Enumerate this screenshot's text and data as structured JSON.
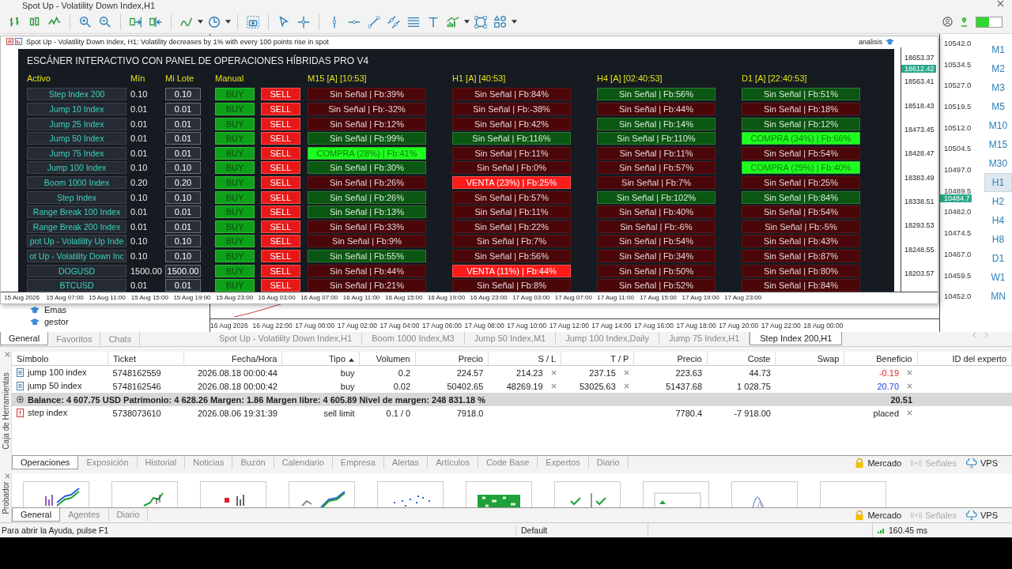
{
  "app_title": "Spot Up - Volatility Down Index,H1",
  "chart_window": {
    "symbol_line": "Spot Up - Volatility Down Index, H1:  Volatility decreases by 1% with every 100 points rise in spot",
    "badge": "analisis",
    "price_labels": [
      "18653.37",
      "18563.41",
      "18518.43",
      "18473.45",
      "18428.47",
      "18383.49",
      "18338.51",
      "18293.53",
      "18248.55",
      "18203.57"
    ],
    "current_price": "18612.42",
    "time_labels": [
      "15 Aug 2026",
      "15 Aug 07:00",
      "15 Aug 11:00",
      "15 Aug 15:00",
      "15 Aug 19:00",
      "15 Aug 23:00",
      "16 Aug 03:00",
      "16 Aug 07:00",
      "16 Aug 11:00",
      "16 Aug 15:00",
      "16 Aug 19:00",
      "16 Aug 23:00",
      "17 Aug 03:00",
      "17 Aug 07:00",
      "17 Aug 11:00",
      "17 Aug 15:00",
      "17 Aug 19:00",
      "17 Aug 23:00"
    ]
  },
  "scanner": {
    "title": "ESCÁNER INTERACTIVO CON PANEL DE OPERACIONES HÍBRIDAS PRO V4",
    "headers": {
      "asset": "Activo",
      "min": "Mín",
      "lot": "Mi Lote",
      "manual": "Manual",
      "timeframes": [
        "M15 [A] [10:53]",
        "H1 [A] [40:53]",
        "H4 [A] [02:40:53]",
        "D1 [A] [22:40:53]"
      ]
    },
    "rows": [
      {
        "symbol": "Step Index 200",
        "min": "0.10",
        "lot": "0.10",
        "buy": "BUY",
        "sell": "SELL",
        "signals": [
          {
            "text": "Sin Señal | Fb:39%",
            "kind": "weak_down"
          },
          {
            "text": "Sin Señal | Fb:84%",
            "kind": "weak_down"
          },
          {
            "text": "Sin Señal | Fb:56%",
            "kind": "weak_up"
          },
          {
            "text": "Sin Señal | Fb:51%",
            "kind": "weak_up"
          }
        ]
      },
      {
        "symbol": "Jump 10 Index",
        "min": "0.01",
        "lot": "0.01",
        "buy": "BUY",
        "sell": "SELL",
        "signals": [
          {
            "text": "Sin Señal | Fb:-32%",
            "kind": "weak_down"
          },
          {
            "text": "Sin Señal | Fb:-38%",
            "kind": "weak_down"
          },
          {
            "text": "Sin Señal | Fb:44%",
            "kind": "weak_down"
          },
          {
            "text": "Sin Señal | Fb:18%",
            "kind": "weak_down"
          }
        ]
      },
      {
        "symbol": "Jump 25 Index",
        "min": "0.01",
        "lot": "0.01",
        "buy": "BUY",
        "sell": "SELL",
        "signals": [
          {
            "text": "Sin Señal | Fb:12%",
            "kind": "weak_down"
          },
          {
            "text": "Sin Señal | Fb:42%",
            "kind": "weak_down"
          },
          {
            "text": "Sin Señal | Fb:14%",
            "kind": "weak_up"
          },
          {
            "text": "Sin Señal | Fb:12%",
            "kind": "weak_up"
          }
        ]
      },
      {
        "symbol": "Jump 50 Index",
        "min": "0.01",
        "lot": "0.01",
        "buy": "BUY",
        "sell": "SELL",
        "signals": [
          {
            "text": "Sin Señal | Fb:99%",
            "kind": "weak_up"
          },
          {
            "text": "Sin Señal | Fb:116%",
            "kind": "weak_up"
          },
          {
            "text": "Sin Señal | Fb:110%",
            "kind": "weak_up"
          },
          {
            "text": "COMPRA (34%) | Fb:66%",
            "kind": "buy"
          }
        ]
      },
      {
        "symbol": "Jump 75 Index",
        "min": "0.01",
        "lot": "0.01",
        "buy": "BUY",
        "sell": "SELL",
        "signals": [
          {
            "text": "COMPRA (28%) | Fb:41%",
            "kind": "buy"
          },
          {
            "text": "Sin Señal | Fb:11%",
            "kind": "weak_down"
          },
          {
            "text": "Sin Señal | Fb:11%",
            "kind": "weak_down"
          },
          {
            "text": "Sin Señal | Fb:54%",
            "kind": "weak_down"
          }
        ]
      },
      {
        "symbol": "Jump 100 Index",
        "min": "0.10",
        "lot": "0.10",
        "buy": "BUY",
        "sell": "SELL",
        "signals": [
          {
            "text": "Sin Señal | Fb:30%",
            "kind": "weak_up"
          },
          {
            "text": "Sin Señal | Fb:0%",
            "kind": "weak_down"
          },
          {
            "text": "Sin Señal | Fb:57%",
            "kind": "weak_down"
          },
          {
            "text": "COMPRA (29%) | Fb:40%",
            "kind": "buy"
          }
        ]
      },
      {
        "symbol": "Boom 1000 Index",
        "min": "0.20",
        "lot": "0.20",
        "buy": "BUY",
        "sell": "SELL",
        "signals": [
          {
            "text": "Sin Señal | Fb:26%",
            "kind": "weak_down"
          },
          {
            "text": "VENTA (23%) | Fb:25%",
            "kind": "sell"
          },
          {
            "text": "Sin Señal | Fb:7%",
            "kind": "weak_down"
          },
          {
            "text": "Sin Señal | Fb:25%",
            "kind": "weak_down"
          }
        ]
      },
      {
        "symbol": "Step Index",
        "min": "0.10",
        "lot": "0.10",
        "buy": "BUY",
        "sell": "SELL",
        "signals": [
          {
            "text": "Sin Señal | Fb:26%",
            "kind": "weak_up"
          },
          {
            "text": "Sin Señal | Fb:57%",
            "kind": "weak_down"
          },
          {
            "text": "Sin Señal | Fb:102%",
            "kind": "weak_up"
          },
          {
            "text": "Sin Señal | Fb:84%",
            "kind": "weak_up"
          }
        ]
      },
      {
        "symbol": "Range Break 100 Index",
        "min": "0.01",
        "lot": "0.01",
        "buy": "BUY",
        "sell": "SELL",
        "signals": [
          {
            "text": "Sin Señal | Fb:13%",
            "kind": "weak_up"
          },
          {
            "text": "Sin Señal | Fb:11%",
            "kind": "weak_down"
          },
          {
            "text": "Sin Señal | Fb:40%",
            "kind": "weak_down"
          },
          {
            "text": "Sin Señal | Fb:54%",
            "kind": "weak_down"
          }
        ]
      },
      {
        "symbol": "Range Break 200 Index",
        "min": "0.01",
        "lot": "0.01",
        "buy": "BUY",
        "sell": "SELL",
        "signals": [
          {
            "text": "Sin Señal | Fb:33%",
            "kind": "weak_down"
          },
          {
            "text": "Sin Señal | Fb:22%",
            "kind": "weak_down"
          },
          {
            "text": "Sin Señal | Fb:-6%",
            "kind": "weak_down"
          },
          {
            "text": "Sin Señal | Fb:-5%",
            "kind": "weak_down"
          }
        ]
      },
      {
        "symbol": "pot Up - Volatility Up Inde",
        "min": "0.10",
        "lot": "0.10",
        "buy": "BUY",
        "sell": "SELL",
        "signals": [
          {
            "text": "Sin Señal | Fb:9%",
            "kind": "weak_down"
          },
          {
            "text": "Sin Señal | Fb:7%",
            "kind": "weak_down"
          },
          {
            "text": "Sin Señal | Fb:54%",
            "kind": "weak_down"
          },
          {
            "text": "Sin Señal | Fb:43%",
            "kind": "weak_down"
          }
        ]
      },
      {
        "symbol": "ot Up - Volatility Down Inc",
        "min": "0.10",
        "lot": "0.10",
        "buy": "BUY",
        "sell": "SELL",
        "signals": [
          {
            "text": "Sin Señal | Fb:55%",
            "kind": "weak_up"
          },
          {
            "text": "Sin Señal | Fb:56%",
            "kind": "weak_down"
          },
          {
            "text": "Sin Señal | Fb:34%",
            "kind": "weak_down"
          },
          {
            "text": "Sin Señal | Fb:87%",
            "kind": "weak_down"
          }
        ]
      },
      {
        "symbol": "DOGUSD",
        "min": "1500.00",
        "lot": "1500.00",
        "buy": "BUY",
        "sell": "SELL",
        "signals": [
          {
            "text": "Sin Señal | Fb:44%",
            "kind": "weak_down"
          },
          {
            "text": "VENTA (11%) | Fb:44%",
            "kind": "sell"
          },
          {
            "text": "Sin Señal | Fb:50%",
            "kind": "weak_down"
          },
          {
            "text": "Sin Señal | Fb:80%",
            "kind": "weak_down"
          }
        ]
      },
      {
        "symbol": "BTCUSD",
        "min": "0.01",
        "lot": "0.01",
        "buy": "BUY",
        "sell": "SELL",
        "signals": [
          {
            "text": "Sin Señal | Fb:21%",
            "kind": "weak_down"
          },
          {
            "text": "Sin Señal | Fb:8%",
            "kind": "weak_down"
          },
          {
            "text": "Sin Señal | Fb:52%",
            "kind": "weak_down"
          },
          {
            "text": "Sin Señal | Fb:84%",
            "kind": "weak_down"
          }
        ]
      }
    ]
  },
  "main_chart": {
    "price_labels": [
      "10542.0",
      "10534.5",
      "10527.0",
      "10519.5",
      "10512.0",
      "10504.5",
      "10497.0",
      "10489.5",
      "10482.0",
      "10474.5",
      "10467.0",
      "10459.5",
      "10452.0"
    ],
    "current_price": "10484.7",
    "time_labels": [
      "16 Aug 2026",
      "16 Aug 22:00",
      "17 Aug 00:00",
      "17 Aug 02:00",
      "17 Aug 04:00",
      "17 Aug 06:00",
      "17 Aug 08:00",
      "17 Aug 10:00",
      "17 Aug 12:00",
      "17 Aug 14:00",
      "17 Aug 16:00",
      "17 Aug 18:00",
      "17 Aug 20:00",
      "17 Aug 22:00",
      "18 Aug 00:00"
    ]
  },
  "timeframes": [
    {
      "label": "M1",
      "selected": false
    },
    {
      "label": "M2",
      "selected": false
    },
    {
      "label": "M3",
      "selected": false
    },
    {
      "label": "M5",
      "selected": false
    },
    {
      "label": "M10",
      "selected": false
    },
    {
      "label": "M15",
      "selected": false
    },
    {
      "label": "M30",
      "selected": false
    },
    {
      "label": "H1",
      "selected": true
    },
    {
      "label": "H2",
      "selected": false
    },
    {
      "label": "H4",
      "selected": false
    },
    {
      "label": "H8",
      "selected": false
    },
    {
      "label": "D1",
      "selected": false
    },
    {
      "label": "W1",
      "selected": false
    },
    {
      "label": "MN",
      "selected": false
    }
  ],
  "navigator": {
    "items": [
      "Emas",
      "gestor"
    ],
    "tabs": [
      {
        "label": "General",
        "selected": true
      },
      {
        "label": "Favoritos",
        "selected": false
      },
      {
        "label": "Chats",
        "selected": false
      }
    ]
  },
  "chart_tabs": [
    {
      "label": "Spot Up - Volatility Down Index,H1",
      "selected": false
    },
    {
      "label": "Boom 1000 Index,M3",
      "selected": false
    },
    {
      "label": "Jump 50 Index,M1",
      "selected": false
    },
    {
      "label": "Jump 100 Index,Daily",
      "selected": false
    },
    {
      "label": "Jump 75 Index,H1",
      "selected": false
    },
    {
      "label": "Step Index 200,H1",
      "selected": true
    }
  ],
  "terminal": {
    "side_label": "Caja de Herramientas",
    "columns": [
      {
        "label": "Símbolo",
        "sorted": false
      },
      {
        "label": "Ticket",
        "sorted": false
      },
      {
        "label": "Fecha/Hora",
        "sorted": false
      },
      {
        "label": "Tipo",
        "sorted": true
      },
      {
        "label": "Volumen",
        "sorted": false
      },
      {
        "label": "Precio",
        "sorted": false
      },
      {
        "label": "S / L",
        "sorted": false
      },
      {
        "label": "T / P",
        "sorted": false
      },
      {
        "label": "Precio",
        "sorted": false
      },
      {
        "label": "Coste",
        "sorted": false
      },
      {
        "label": "Swap",
        "sorted": false
      },
      {
        "label": "Beneficio",
        "sorted": false
      },
      {
        "label": "ID del experto",
        "sorted": false
      }
    ],
    "rows": [
      {
        "kind": "position",
        "symbol": "jump 100 index",
        "ticket": "5748162559",
        "time": "2026.08.18 00:00:44",
        "type": "buy",
        "volume": "0.2",
        "price": "224.57",
        "sl": "214.23",
        "tp": "237.15",
        "current": "223.63",
        "cost": "44.73",
        "profit": "-0.19",
        "loss": true,
        "pending": false
      },
      {
        "kind": "position",
        "symbol": "jump 50 index",
        "ticket": "5748162546",
        "time": "2026.08.18 00:00:42",
        "type": "buy",
        "volume": "0.02",
        "price": "50402.65",
        "sl": "48269.19",
        "tp": "53025.63",
        "current": "51437.68",
        "cost": "1 028.75",
        "profit": "20.70",
        "loss": false,
        "pending": false
      }
    ],
    "balance": {
      "text": "Balance: 4 607.75 USD  Patrimonio: 4 628.26  Margen: 1.86  Margen libre: 4 605.89  Nivel de margen: 248 831.18 %",
      "profit": "20.51"
    },
    "orders": [
      {
        "kind": "order",
        "symbol": "step index",
        "ticket": "5738073610",
        "time": "2026.08.06 19:31:39",
        "type": "sell limit",
        "volume": "0.1 / 0",
        "price": "7918.0",
        "current": "7780.4",
        "cost": "-7 918.00",
        "profit": "placed",
        "pending": true
      }
    ],
    "tabs": [
      {
        "label": "Operaciones",
        "selected": true
      },
      {
        "label": "Exposición",
        "selected": false
      },
      {
        "label": "Historial",
        "selected": false
      },
      {
        "label": "Noticias",
        "selected": false
      },
      {
        "label": "Buzón",
        "selected": false
      },
      {
        "label": "Calendario",
        "selected": false
      },
      {
        "label": "Empresa",
        "selected": false
      },
      {
        "label": "Alertas",
        "selected": false
      },
      {
        "label": "Artículos",
        "selected": false
      },
      {
        "label": "Code Base",
        "selected": false
      },
      {
        "label": "Expertos",
        "selected": false
      },
      {
        "label": "Diario",
        "selected": false
      }
    ],
    "links": [
      {
        "label": "Mercado",
        "kind": "market",
        "disabled": false
      },
      {
        "label": "Señales",
        "kind": "signals",
        "disabled": true
      },
      {
        "label": "VPS",
        "kind": "vps",
        "disabled": false
      }
    ]
  },
  "tester": {
    "side_label": "Probador",
    "tabs": [
      {
        "label": "General",
        "selected": true
      },
      {
        "label": "Agentes",
        "selected": false
      },
      {
        "label": "Diario",
        "selected": false
      }
    ],
    "links": [
      {
        "label": "Mercado",
        "kind": "market",
        "disabled": false
      },
      {
        "label": "Señales",
        "kind": "signals",
        "disabled": true
      },
      {
        "label": "VPS",
        "kind": "vps",
        "disabled": false
      }
    ]
  },
  "status_bar": {
    "help": "Para abrir la Ayuda, pulse F1",
    "profile": "Default",
    "ping": "160.45 ms"
  }
}
